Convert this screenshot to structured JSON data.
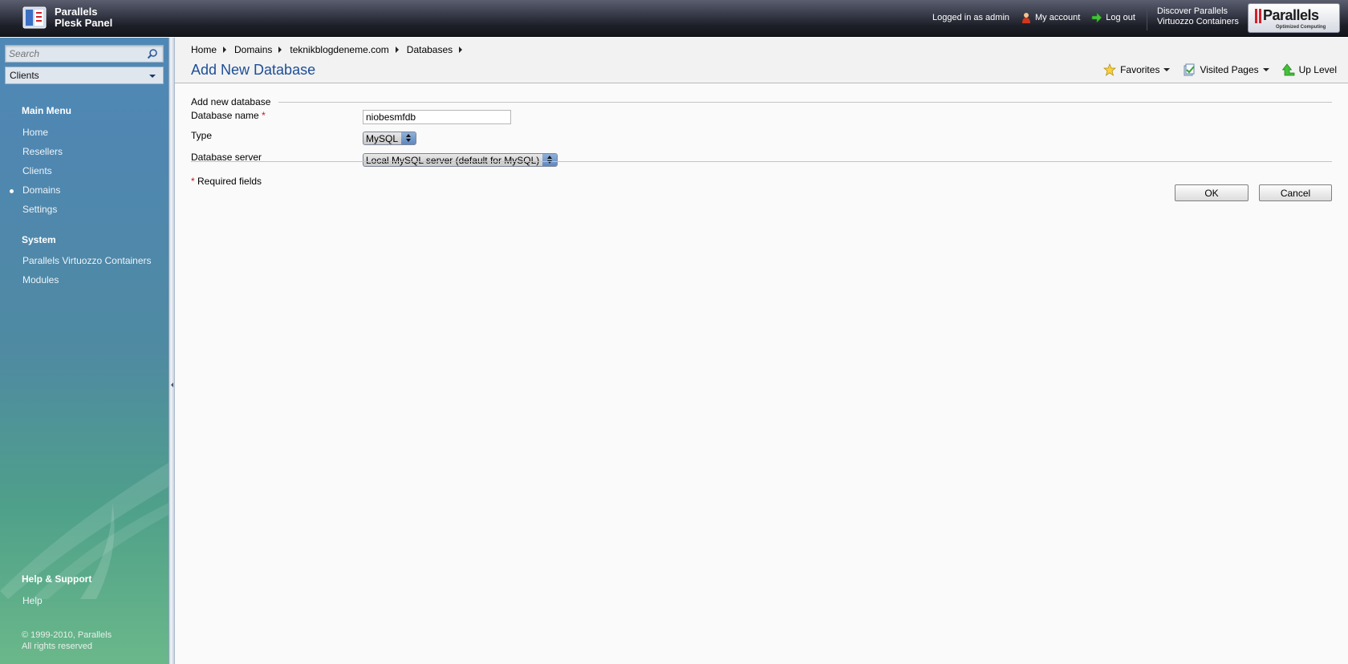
{
  "header": {
    "product_line1": "Parallels",
    "product_line2": "Plesk Panel",
    "logged_in": "Logged in as admin",
    "my_account": "My account",
    "log_out": "Log out",
    "discover_line1": "Discover Parallels",
    "discover_line2": "Virtuozzo Containers",
    "badge_brand": "Parallels",
    "badge_tagline": "Optimized Computing"
  },
  "sidebar": {
    "search_placeholder": "Search",
    "client_select": "Clients",
    "main_menu_title": "Main Menu",
    "main_menu": [
      {
        "label": "Home",
        "active": false
      },
      {
        "label": "Resellers",
        "active": false
      },
      {
        "label": "Clients",
        "active": false
      },
      {
        "label": "Domains",
        "active": true
      },
      {
        "label": "Settings",
        "active": false
      }
    ],
    "system_title": "System",
    "system_menu": [
      {
        "label": "Parallels Virtuozzo Containers"
      },
      {
        "label": "Modules"
      }
    ],
    "help_title": "Help & Support",
    "help_menu": [
      {
        "label": "Help"
      }
    ],
    "copyright_line1": "© 1999-2010, Parallels",
    "copyright_line2": "All rights reserved"
  },
  "breadcrumb": [
    "Home",
    "Domains",
    "teknikblogdeneme.com",
    "Databases"
  ],
  "page": {
    "title": "Add New Database",
    "tools": {
      "favorites": "Favorites",
      "visited_pages": "Visited Pages",
      "up_level": "Up Level"
    }
  },
  "form": {
    "legend": "Add new database",
    "name_label": "Database name",
    "required_mark": "*",
    "name_value": "niobesmfdb",
    "type_label": "Type",
    "type_value": "MySQL",
    "server_label": "Database server",
    "server_value": "Local MySQL server (default for MySQL)",
    "required_note": "Required fields",
    "ok": "OK",
    "cancel": "Cancel"
  },
  "colors": {
    "title_blue": "#1c4e96",
    "required_red": "#c3141b",
    "topbar": "#1e2029"
  },
  "icons": {
    "my_account": "user-icon",
    "log_out": "arrow-right-icon",
    "favorites": "star-icon",
    "visited_pages": "pages-check-icon",
    "up_level": "up-arrow-icon",
    "search": "magnifier-icon"
  }
}
